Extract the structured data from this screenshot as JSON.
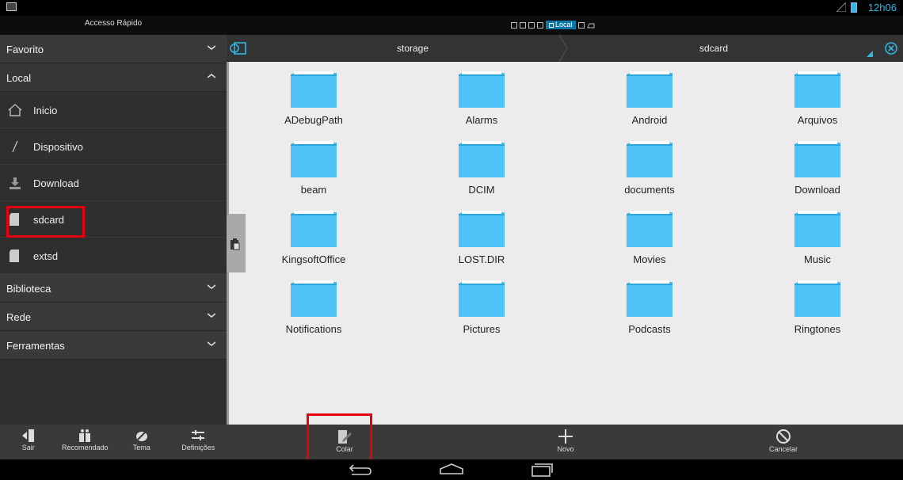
{
  "status_bar": {
    "time": "12h06"
  },
  "title_row": {
    "quick_access": "Accesso Rápido",
    "active_window": "Local"
  },
  "sidebar": {
    "sections": [
      {
        "label": "Favorito"
      },
      {
        "label": "Local"
      },
      {
        "label": "Biblioteca"
      },
      {
        "label": "Rede"
      },
      {
        "label": "Ferramentas"
      }
    ],
    "local_items": [
      {
        "label": "Inicio",
        "icon": "home-icon"
      },
      {
        "label": "Dispositivo",
        "icon": "slash-icon"
      },
      {
        "label": "Download",
        "icon": "download-icon"
      },
      {
        "label": "sdcard",
        "icon": "sdcard-icon"
      },
      {
        "label": "extsd",
        "icon": "sdcard-icon"
      }
    ],
    "bottom": [
      {
        "label": "Sair",
        "icon": "exit-icon"
      },
      {
        "label": "Recomendado",
        "icon": "gift-icon"
      },
      {
        "label": "Tema",
        "icon": "palette-icon"
      },
      {
        "label": "Definições",
        "icon": "sliders-icon"
      }
    ]
  },
  "breadcrumb": {
    "items": [
      "storage",
      "sdcard"
    ]
  },
  "folders": [
    "ADebugPath",
    "Alarms",
    "Android",
    "Arquivos",
    "beam",
    "DCIM",
    "documents",
    "Download",
    "KingsoftOffice",
    "LOST.DIR",
    "Movies",
    "Music",
    "Notifications",
    "Pictures",
    "Podcasts",
    "Ringtones"
  ],
  "actions": {
    "paste": "Colar",
    "new": "Novo",
    "cancel": "Cancelar"
  },
  "colors": {
    "accent": "#33b5e5",
    "folder": "#4fc3f7",
    "highlight": "#e3000f"
  }
}
